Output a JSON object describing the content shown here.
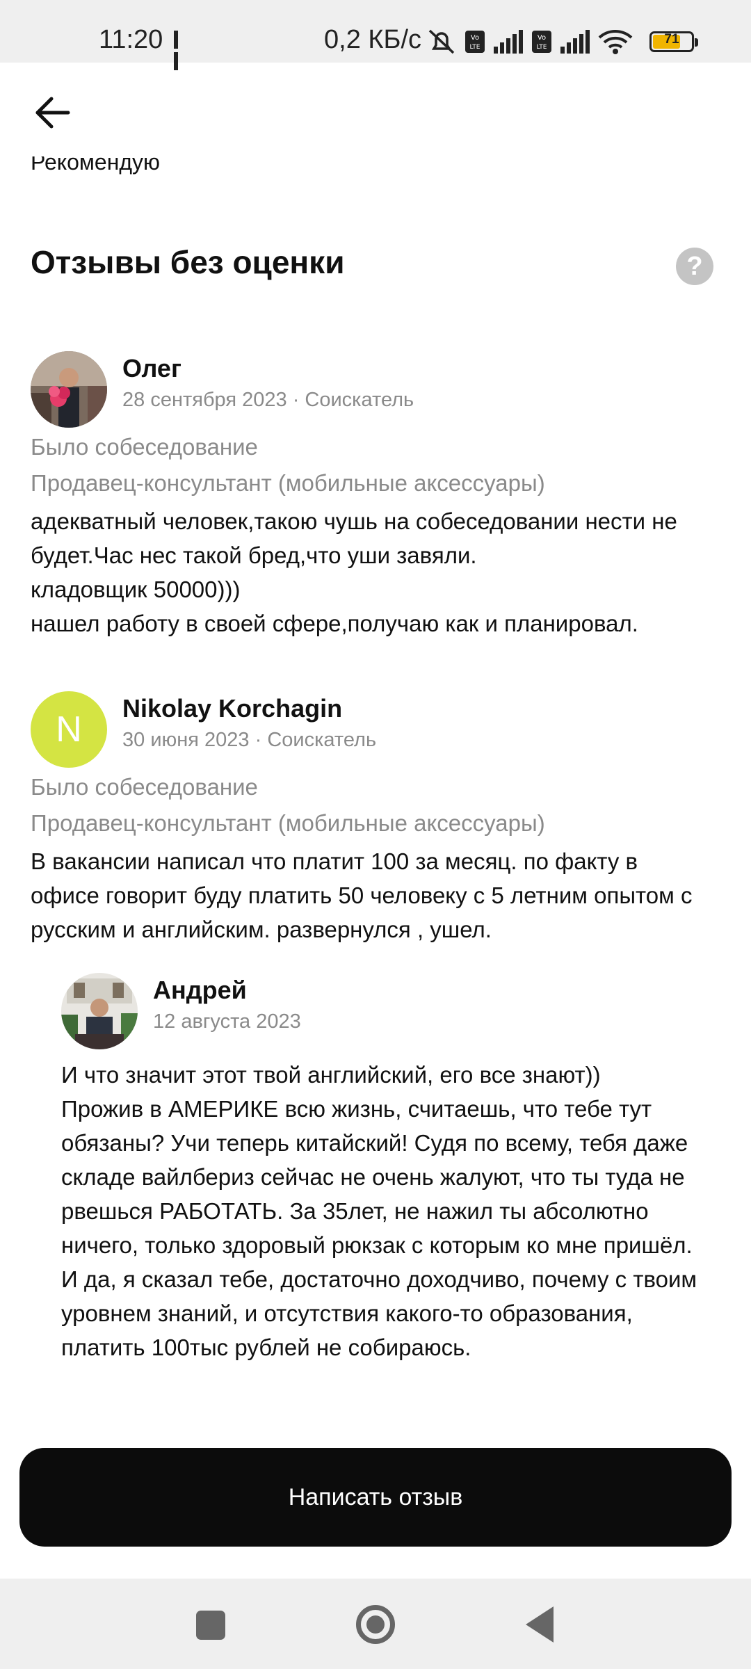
{
  "status_bar": {
    "time": "11:20",
    "speed": "0,2 КБ/с",
    "battery": "71",
    "battery_color": "#f0b400"
  },
  "header": {
    "back_icon": "arrow-left-icon",
    "cut_text": "Рекомендую"
  },
  "section": {
    "title": "Отзывы без оценки",
    "help_icon": "question-icon",
    "help_glyph": "?"
  },
  "reviews": [
    {
      "author": "Олег",
      "meta": "28 сентября 2023 · Соискатель",
      "status": "Было собеседование",
      "position": "Продавец-консультант (мобильные аксессуары)",
      "lines": [
        "адекватный человек,такою чушь на собеседовании нести не",
        "будет.Час нес такой бред,что уши завяли.",
        "кладовщик 50000)))",
        "нашел работу в своей сфере,получаю как и планировал."
      ]
    },
    {
      "author": "Nikolay Korchagin",
      "avatar_letter": "N",
      "avatar_color": "#d4e443",
      "meta": "30 июня 2023 · Соискатель",
      "status": "Было собеседование",
      "position": "Продавец-консультант (мобильные аксессуары)",
      "lines": [
        "В вакансии написал что платит 100 за месяц. по факту в",
        "офисе говорит буду платить 50 человеку с 5 летним опытом с",
        "русским и английским. развернулся , ушел."
      ]
    }
  ],
  "reply": {
    "author": "Андрей",
    "meta": "12 августа 2023",
    "lines": [
      "И что значит этот твой английский, его все знают))",
      "Прожив в АМЕРИКЕ всю жизнь, считаешь, что тебе тут",
      "обязаны? Учи теперь китайский! Судя по всему, тебя даже",
      "складе вайлбериз сейчас не очень жалуют, что ты туда не",
      "рвешься РАБОТАТЬ. За 35лет, не нажил ты абсолютно",
      "ничего, только здоровый рюкзак с которым ко мне пришёл.",
      "И да, я сказал тебе, достаточно доходчиво, почему с твоим",
      "уровнем знаний, и отсутствия какого-то образования,",
      "платить 100тыс рублей не собираюсь."
    ]
  },
  "footer": {
    "write_review": "Написать отзыв"
  },
  "nav": {
    "recents_icon": "square-icon",
    "home_icon": "circle-icon",
    "back_icon": "triangle-back-icon"
  }
}
